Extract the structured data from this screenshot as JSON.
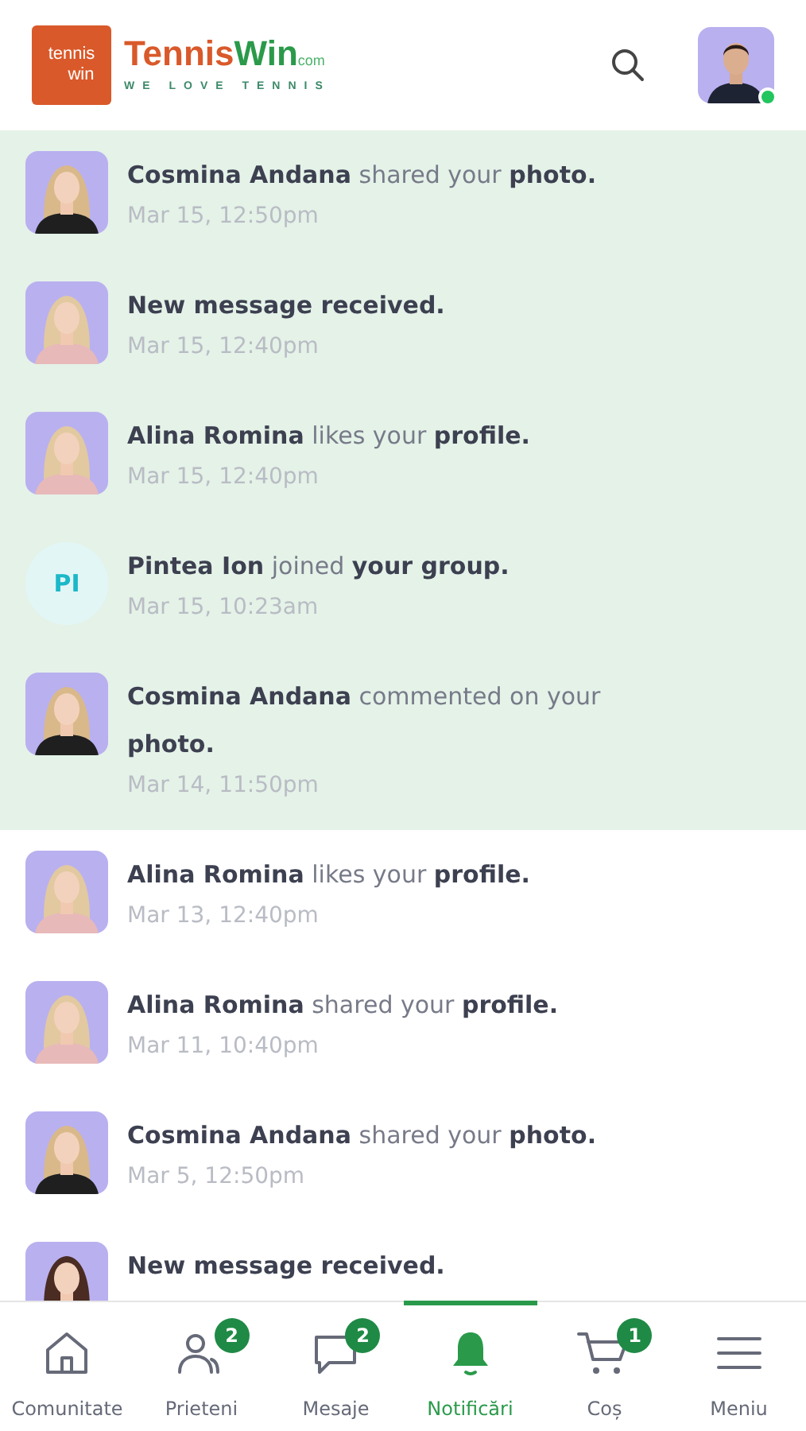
{
  "header": {
    "logo": {
      "mark_top": "tennis",
      "mark_bottom": "win",
      "name_a": "Tennis",
      "name_b": "Win",
      "suffix": "com",
      "tagline": "WE LOVE TENNIS"
    },
    "user_online": true
  },
  "notifications": [
    {
      "text": "**Cosmina Andana** shared your **photo.**",
      "time": "Mar 15, 12:50pm",
      "unread": true
    },
    {
      "text": "**New message received.**",
      "time": "Mar 15, 12:40pm",
      "unread": true
    },
    {
      "text": "**Alina Romina** likes your **profile.**",
      "time": "Mar 15, 12:40pm",
      "unread": true
    },
    {
      "avatar": {
        "kind": "initials",
        "initials": "PI"
      },
      "text": "**Pintea Ion** joined **your group.**",
      "time": "Mar 15, 10:23am",
      "unread": true
    },
    {
      "text": "**Cosmina Andana** commented on your **photo.**",
      "time": "Mar 14, 11:50pm",
      "unread": true
    },
    {
      "text": "**Alina Romina** likes your **profile.**",
      "time": "Mar 13, 12:40pm",
      "unread": false
    },
    {
      "text": "**Alina Romina** shared your **profile.**",
      "time": "Mar 11, 10:40pm",
      "unread": false
    },
    {
      "text": "**Cosmina Andana** shared your **photo.**",
      "time": "Mar 5, 12:50pm",
      "unread": false
    },
    {
      "text": "**New message received.**",
      "unread": false
    }
  ],
  "nav": [
    {
      "kind": "home",
      "label": "Comunitate",
      "selected": false
    },
    {
      "kind": "friends",
      "label": "Prieteni",
      "badge": "2",
      "selected": false
    },
    {
      "kind": "messages",
      "label": "Mesaje",
      "badge": "2",
      "selected": false
    },
    {
      "kind": "bell",
      "label": "Notificări",
      "selected": true
    },
    {
      "kind": "cart",
      "label": "Coș",
      "badge": "1",
      "selected": false
    },
    {
      "kind": "menu",
      "label": "Meniu",
      "selected": false
    }
  ]
}
